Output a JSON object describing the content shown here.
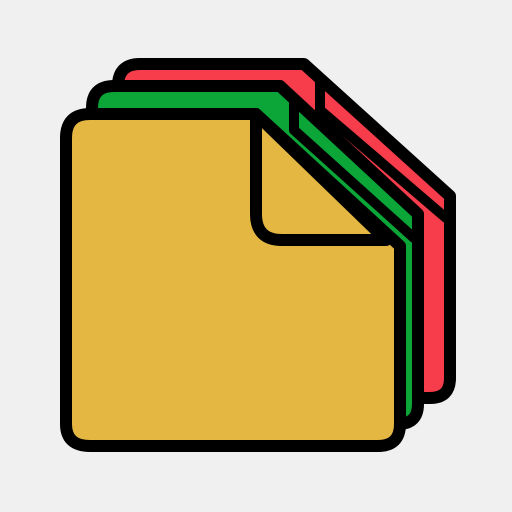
{
  "icon": {
    "name": "stacked-documents-icon",
    "colors": {
      "background": "#f0f0f0",
      "outline": "#000000",
      "back_page": "#f73d4b",
      "middle_page": "#0ba637",
      "front_page": "#e4b743"
    }
  }
}
